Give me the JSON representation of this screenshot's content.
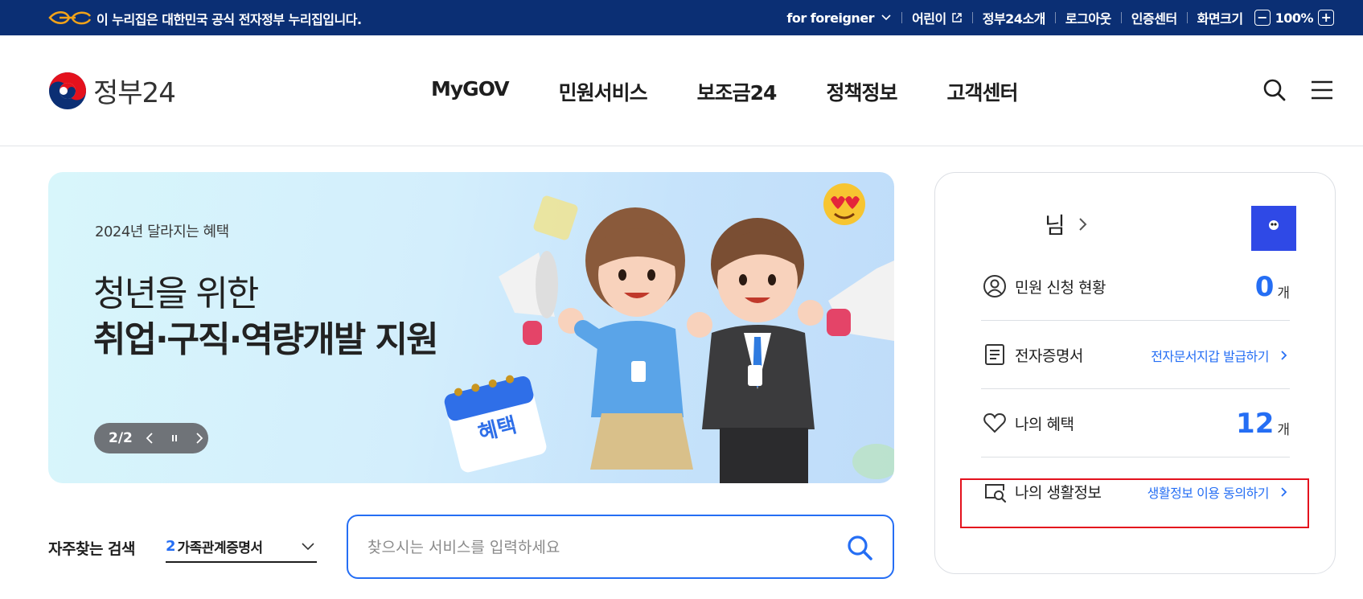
{
  "gov_bar": {
    "notice": "이 누리집은 대한민국 공식 전자정부 누리집입니다.",
    "links": [
      {
        "label": "for foreigner"
      },
      {
        "label": "어린이"
      },
      {
        "label": "정부24소개"
      },
      {
        "label": "로그아웃"
      },
      {
        "label": "인증센터"
      },
      {
        "label": "화면크기"
      }
    ],
    "zoom_value": "100%",
    "zoom_minus": "−",
    "zoom_plus": "+"
  },
  "header": {
    "logo_text": "정부24",
    "nav": [
      "MyGOV",
      "민원서비스",
      "보조금24",
      "정책정보",
      "고객센터"
    ],
    "icons": [
      "search-icon",
      "menu-icon"
    ]
  },
  "banner": {
    "subtitle": "2024년 달라지는 혜택",
    "title_line1": "청년을 위한",
    "title_line2": "취업·구직·역량개발 지원",
    "pager": "2/2",
    "calendar_label": "혜택"
  },
  "search": {
    "favorites_label": "자주찾는 검색",
    "selected_number": "2",
    "selected_text": "가족관계증명서",
    "placeholder": "찾으시는 서비스를 입력하세요"
  },
  "user_card": {
    "user_suffix": "님",
    "rows": [
      {
        "label": "민원 신청 현황",
        "value": "0",
        "unit": "개"
      },
      {
        "label": "전자증명서",
        "link": "전자문서지갑 발급하기"
      },
      {
        "label": "나의 혜택",
        "value": "12",
        "unit": "개"
      },
      {
        "label": "나의 생활정보",
        "link": "생활정보 이용 동의하기"
      }
    ]
  },
  "colors": {
    "gov_bar": "#0b2f74",
    "accent_blue": "#256ef4",
    "highlight_red": "#e4111d",
    "avatar_bg": "#2f49e6"
  }
}
